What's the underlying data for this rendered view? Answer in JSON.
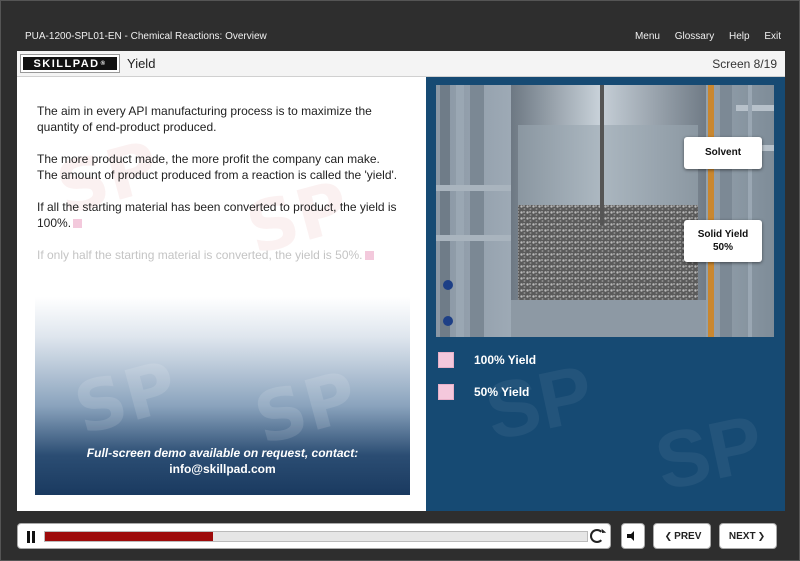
{
  "app": {
    "course_title": "PUA-1200-SPL01-EN - Chemical Reactions: Overview",
    "nav": [
      "Menu",
      "Glossary",
      "Help",
      "Exit"
    ]
  },
  "header": {
    "logo_text": "SKILLPAD",
    "logo_mark": "®",
    "screen_title": "Yield",
    "screen_counter": "Screen 8/19"
  },
  "content": {
    "paragraphs": [
      "The aim in every API manufacturing process is to maximize the quantity of end-product produced.",
      "The more product made, the more profit the company can make. The amount of product produced from a reaction is called the 'yield'.",
      "If all the starting material has been converted to product, the yield is 100%.",
      "If only half the starting material is converted, the yield is 50%."
    ],
    "demo_notice": "Full-screen demo available on request, contact:",
    "demo_email": "info@skillpad.com",
    "watermark": "SP"
  },
  "figure": {
    "callout_solvent": "Solvent",
    "callout_solid_line1": "Solid Yield",
    "callout_solid_line2": "50%"
  },
  "options": [
    {
      "label": "100% Yield"
    },
    {
      "label": "50% Yield"
    }
  ],
  "controls": {
    "progress": 0.31,
    "prev_label": "PREV",
    "next_label": "NEXT",
    "accent_color": "#9e0b0b"
  },
  "colors": {
    "panel_blue": "#164a73",
    "swatch_pink": "#f4c8dc"
  }
}
